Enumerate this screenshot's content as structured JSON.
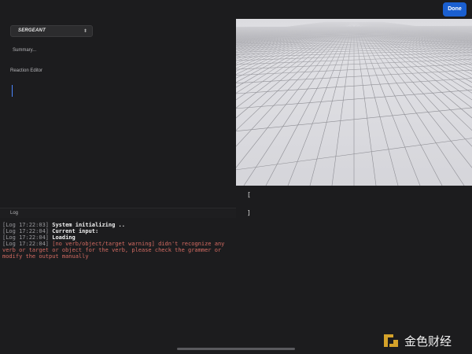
{
  "topbar": {
    "done_label": "Done"
  },
  "role_select": {
    "selected": "SERGEANT",
    "icon": "chevron-updown-icon"
  },
  "summary": {
    "text": "Summary..."
  },
  "reaction_editor": {
    "label": "Reaction Editor",
    "value": ""
  },
  "output": {
    "open_bracket": "[",
    "close_bracket": "]"
  },
  "log": {
    "label": "Log",
    "entries": [
      {
        "ts": "[Log 17:22:03]",
        "msg": "System initializing ..",
        "level": "info"
      },
      {
        "ts": "[Log 17:22:04]",
        "msg": "Current input:",
        "level": "info"
      },
      {
        "ts": "[Log 17:22:04]",
        "msg": "Loading",
        "level": "info"
      },
      {
        "ts": "[Log 17:22:04]",
        "msg": "[no verb/object/target warning] didn't recognize any verb or target or object for the verb, please check the grammer or modify the output manually",
        "level": "warning"
      }
    ]
  },
  "watermark": {
    "text": "金色财经",
    "logo_icon": "gold-bracket-logo"
  },
  "colors": {
    "accent": "#1a5fd0",
    "background": "#1c1c1e",
    "warning": "#d46b62"
  }
}
